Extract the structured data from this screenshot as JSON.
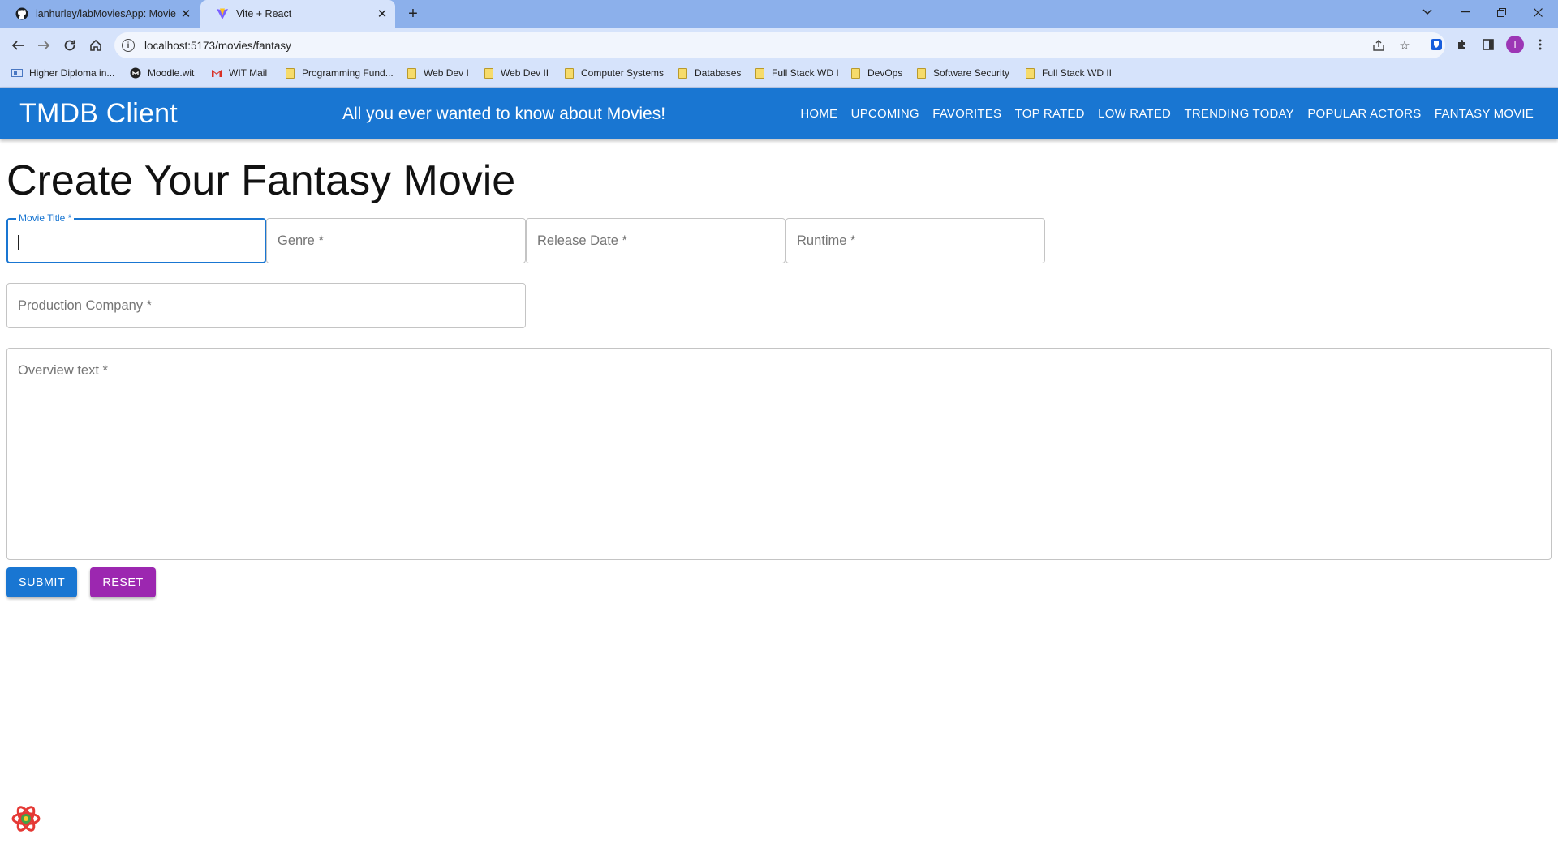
{
  "browser": {
    "tabs": [
      {
        "title": "ianhurley/labMoviesApp: Movie",
        "active": false
      },
      {
        "title": "Vite + React",
        "active": true
      }
    ],
    "url": "localhost:5173/movies/fantasy",
    "bookmarks": [
      {
        "label": "Higher Diploma in...",
        "icon": "doc-icon"
      },
      {
        "label": "Moodle.wit",
        "icon": "moodle-icon"
      },
      {
        "label": "WIT Mail",
        "icon": "gmail-icon"
      },
      {
        "label": "Programming Fund...",
        "icon": "folder-icon"
      },
      {
        "label": "Web Dev I",
        "icon": "folder-icon"
      },
      {
        "label": "Web Dev II",
        "icon": "folder-icon"
      },
      {
        "label": "Computer Systems",
        "icon": "folder-icon"
      },
      {
        "label": "Databases",
        "icon": "folder-icon"
      },
      {
        "label": "Full Stack WD I",
        "icon": "folder-icon"
      },
      {
        "label": "DevOps",
        "icon": "folder-icon"
      },
      {
        "label": "Software Security",
        "icon": "folder-icon"
      },
      {
        "label": "Full Stack WD II",
        "icon": "folder-icon"
      }
    ],
    "profile_initial": "I"
  },
  "header": {
    "brand": "TMDB Client",
    "tagline": "All you ever wanted to know about Movies!",
    "menu": [
      "HOME",
      "UPCOMING",
      "FAVORITES",
      "TOP RATED",
      "LOW RATED",
      "TRENDING TODAY",
      "POPULAR ACTORS",
      "FANTASY MOVIE"
    ],
    "color": "#1976d2"
  },
  "form": {
    "title": "Create Your Fantasy Movie",
    "movie_title_label": "Movie Title *",
    "movie_title_value": "",
    "genre_placeholder": "Genre *",
    "release_date_placeholder": "Release Date *",
    "runtime_placeholder": "Runtime *",
    "production_company_placeholder": "Production Company *",
    "overview_placeholder": "Overview text *",
    "submit_label": "SUBMIT",
    "reset_label": "RESET",
    "submit_color": "#1976d2",
    "reset_color": "#9c27b0"
  }
}
